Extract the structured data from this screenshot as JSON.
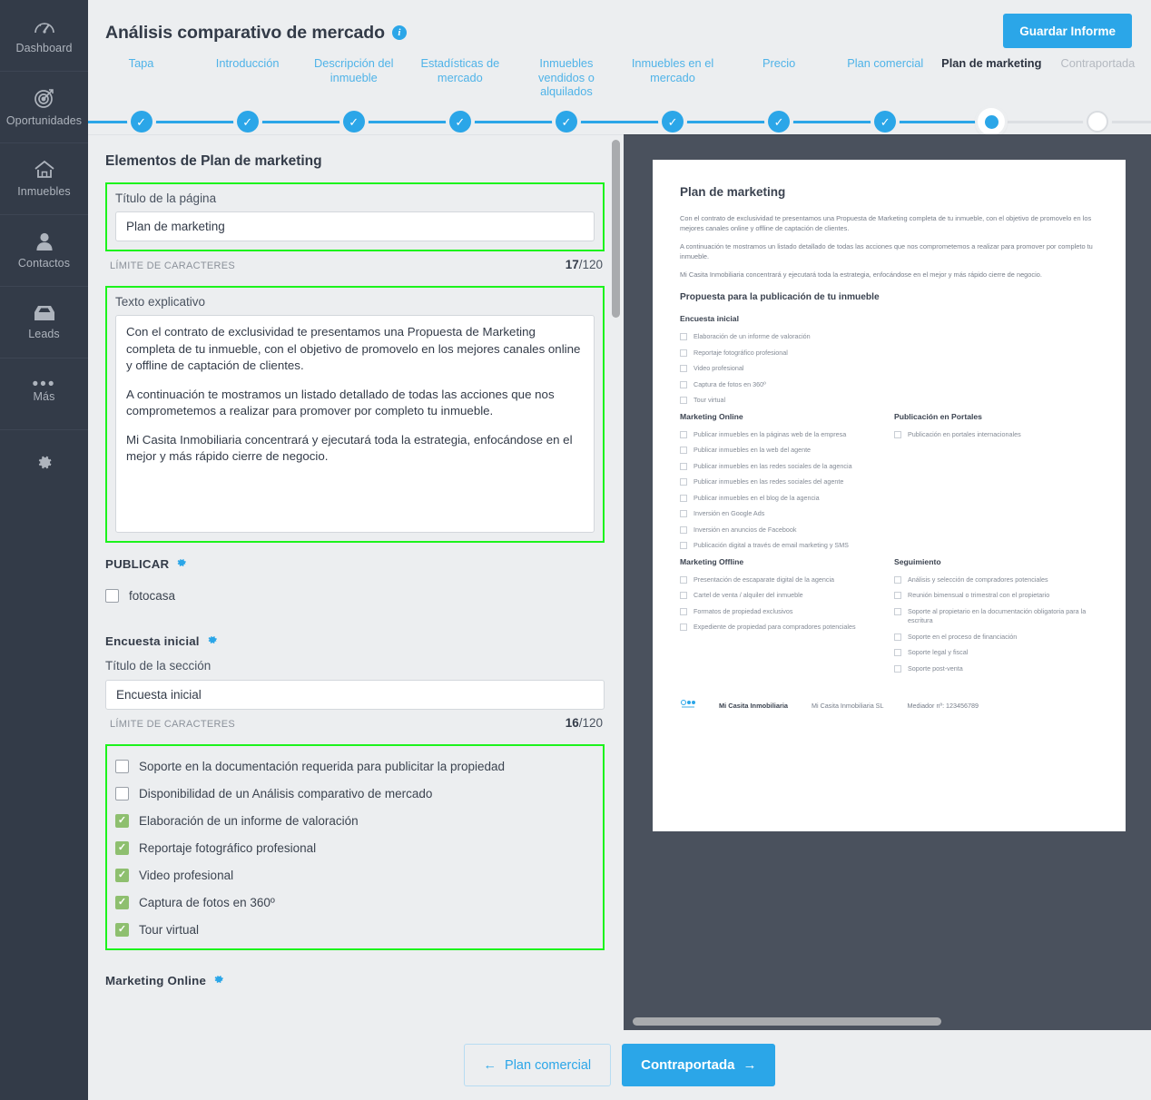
{
  "sidebar": {
    "items": [
      {
        "label": "Dashboard",
        "icon": "gauge-icon"
      },
      {
        "label": "Oportunidades",
        "icon": "target-icon"
      },
      {
        "label": "Inmuebles",
        "icon": "home-icon"
      },
      {
        "label": "Contactos",
        "icon": "user-icon"
      },
      {
        "label": "Leads",
        "icon": "inbox-icon"
      },
      {
        "label": "Más",
        "icon": "ellipsis-icon"
      }
    ],
    "settings_icon": "gear-icon"
  },
  "header": {
    "title": "Análisis comparativo de mercado",
    "info_icon": "info-icon",
    "save_label": "Guardar Informe"
  },
  "stepper": {
    "steps": [
      {
        "label": "Tapa",
        "state": "done"
      },
      {
        "label": "Introducción",
        "state": "done"
      },
      {
        "label": "Descripción del inmueble",
        "state": "done"
      },
      {
        "label": "Estadísticas de mercado",
        "state": "done"
      },
      {
        "label": "Inmuebles vendidos o alquilados",
        "state": "done"
      },
      {
        "label": "Inmuebles en el mercado",
        "state": "done"
      },
      {
        "label": "Precio",
        "state": "done"
      },
      {
        "label": "Plan comercial",
        "state": "done"
      },
      {
        "label": "Plan de marketing",
        "state": "current"
      },
      {
        "label": "Contraportada",
        "state": "future"
      }
    ]
  },
  "form": {
    "section_title": "Elementos de Plan de marketing",
    "page_title_field": {
      "label": "Título de la página",
      "value": "Plan de marketing",
      "limit_label": "LÍMITE DE CARACTERES",
      "count": "17",
      "max": "/120"
    },
    "explain_field": {
      "label": "Texto explicativo",
      "p1": "Con el contrato de exclusividad te presentamos una Propuesta de Marketing completa de tu inmueble, con el objetivo de promovelo en los mejores canales online y offline de captación de clientes.",
      "p2": "A continuación te mostramos un listado detallado de todas las acciones que nos comprometemos a realizar para promover por completo tu inmueble.",
      "p3": "Mi Casita Inmobiliaria concentrará y ejecutará toda la estrategia, enfocándose en el mejor y más rápido cierre de negocio."
    },
    "publicar": {
      "title": "PUBLICAR",
      "gear_icon": "gear-icon",
      "items": [
        {
          "label": "fotocasa",
          "checked": false
        }
      ]
    },
    "encuesta": {
      "title": "Encuesta inicial",
      "gear_icon": "gear-icon",
      "section_label": "Título de la sección",
      "value": "Encuesta inicial",
      "limit_label": "LÍMITE DE CARACTERES",
      "count": "16",
      "max": "/120",
      "items": [
        {
          "label": "Soporte en la documentación requerida para publicitar la propiedad",
          "checked": false
        },
        {
          "label": "Disponibilidad de un Análisis comparativo de mercado",
          "checked": false
        },
        {
          "label": "Elaboración de un informe de valoración",
          "checked": true
        },
        {
          "label": "Reportaje fotográfico profesional",
          "checked": true
        },
        {
          "label": "Video profesional",
          "checked": true
        },
        {
          "label": "Captura de fotos en 360º",
          "checked": true
        },
        {
          "label": "Tour virtual",
          "checked": true
        }
      ]
    },
    "marketing_online": {
      "title": "Marketing Online",
      "gear_icon": "gear-icon"
    }
  },
  "preview": {
    "title": "Plan de marketing",
    "p1": "Con el contrato de exclusividad te presentamos una Propuesta de Marketing completa de tu inmueble, con el objetivo de promovelo en los mejores canales online y offline de captación de clientes.",
    "p2": "A continuación te mostramos un listado detallado de todas las acciones que nos comprometemos a realizar para promover por completo tu inmueble.",
    "p3": "Mi Casita Inmobiliaria concentrará y ejecutará toda la estrategia, enfocándose en el mejor y más rápido cierre de negocio.",
    "subtitle": "Propuesta para la publicación de tu inmueble",
    "groups": [
      {
        "title": "Encuesta inicial",
        "items": [
          "Elaboración de un informe de valoración",
          "Reportaje fotográfico profesional",
          "Video profesional",
          "Captura de fotos en 360º",
          "Tour virtual"
        ]
      },
      {
        "title": "Marketing Online",
        "items": [
          "Publicar inmuebles en la páginas web de la empresa",
          "Publicar inmuebles en la web del agente",
          "Publicar inmuebles en las redes sociales de la agencia",
          "Publicar inmuebles en las redes sociales del agente",
          "Publicar inmuebles en el blog de la agencia",
          "Inversión en Google Ads",
          "Inversión en anuncios de Facebook",
          "Publicación digital a través de email marketing y SMS"
        ]
      },
      {
        "title": "Publicación en Portales",
        "items": [
          "Publicación en portales internacionales"
        ]
      },
      {
        "title": "Marketing Offline",
        "items": [
          "Presentación de escaparate digital de la agencia",
          "Cartel de venta / alquiler del inmueble",
          "Formatos de propiedad exclusivos",
          "Expediente de propiedad para compradores potenciales"
        ]
      },
      {
        "title": "Seguimiento",
        "items": [
          "Análisis y selección de compradores potenciales",
          "Reunión bimensual o trimestral con el propietario",
          "Soporte al propietario en la documentación obligatoria para la escritura",
          "Soporte en el proceso de financiación",
          "Soporte legal y fiscal",
          "Soporte post-venta"
        ]
      }
    ],
    "footer": {
      "brand": "Mi Casita Inmobiliaria",
      "company": "Mi Casita Inmobiliaria SL",
      "license": "Mediador nº: 123456789"
    }
  },
  "footer_nav": {
    "prev_label": "Plan comercial",
    "next_label": "Contraportada",
    "prev_arrow": "←",
    "next_arrow": "→"
  },
  "colors": {
    "accent": "#2ba6e8",
    "sidebar": "#333b48",
    "preview_bg": "#4a515d",
    "highlight": "#1cf31c",
    "checked": "#8ebf6f"
  }
}
